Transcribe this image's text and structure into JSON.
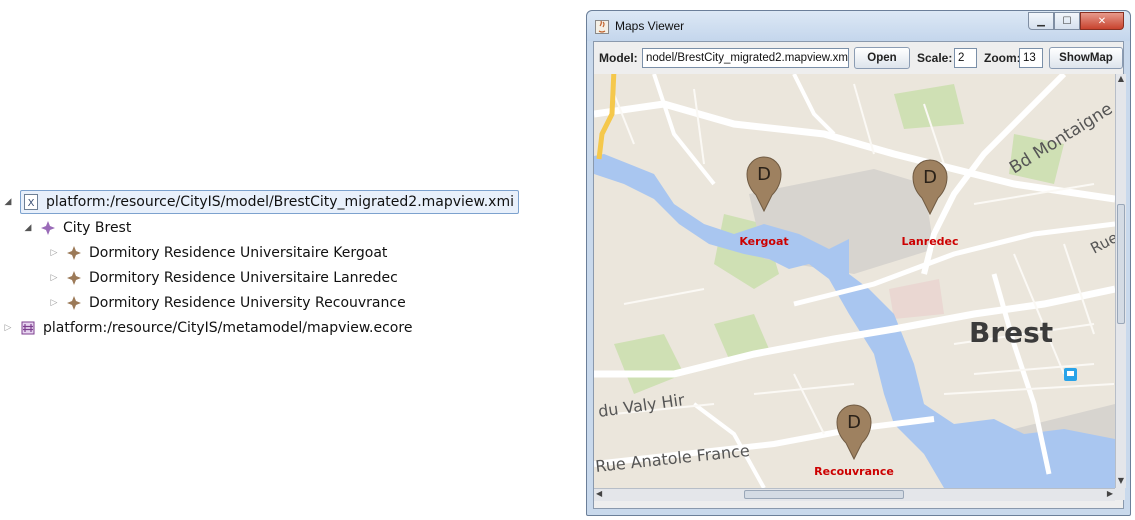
{
  "tree": {
    "root": "platform:/resource/CityIS/model/BrestCity_migrated2.mapview.xmi",
    "city": "City Brest",
    "children": [
      "Dormitory Residence Universitaire Kergoat",
      "Dormitory Residence Universitaire Lanredec",
      "Dormitory Residence University Recouvrance"
    ],
    "ecore": "platform:/resource/CityIS/metamodel/mapview.ecore"
  },
  "window": {
    "title": "Maps Viewer",
    "model_label": "Model:",
    "model_value": "nodel/BrestCity_migrated2.mapview.xmi",
    "open_label": "Open",
    "scale_label": "Scale:",
    "scale_value": "2",
    "zoom_label": "Zoom:",
    "zoom_value": "13",
    "showmap_label": "ShowMap"
  },
  "map": {
    "markers": [
      {
        "letter": "D",
        "label": "Kergoat"
      },
      {
        "letter": "D",
        "label": "Lanredec"
      },
      {
        "letter": "D",
        "label": "Recouvrance"
      }
    ],
    "city_label": "Brest",
    "street_labels": [
      "Bd Montaigne",
      "Rue",
      "du Valy Hir",
      "Rue Anatole France"
    ],
    "colors": {
      "water": "#a9c6f0",
      "marker": "#9e8160",
      "marker_label": "#cc0000"
    }
  }
}
